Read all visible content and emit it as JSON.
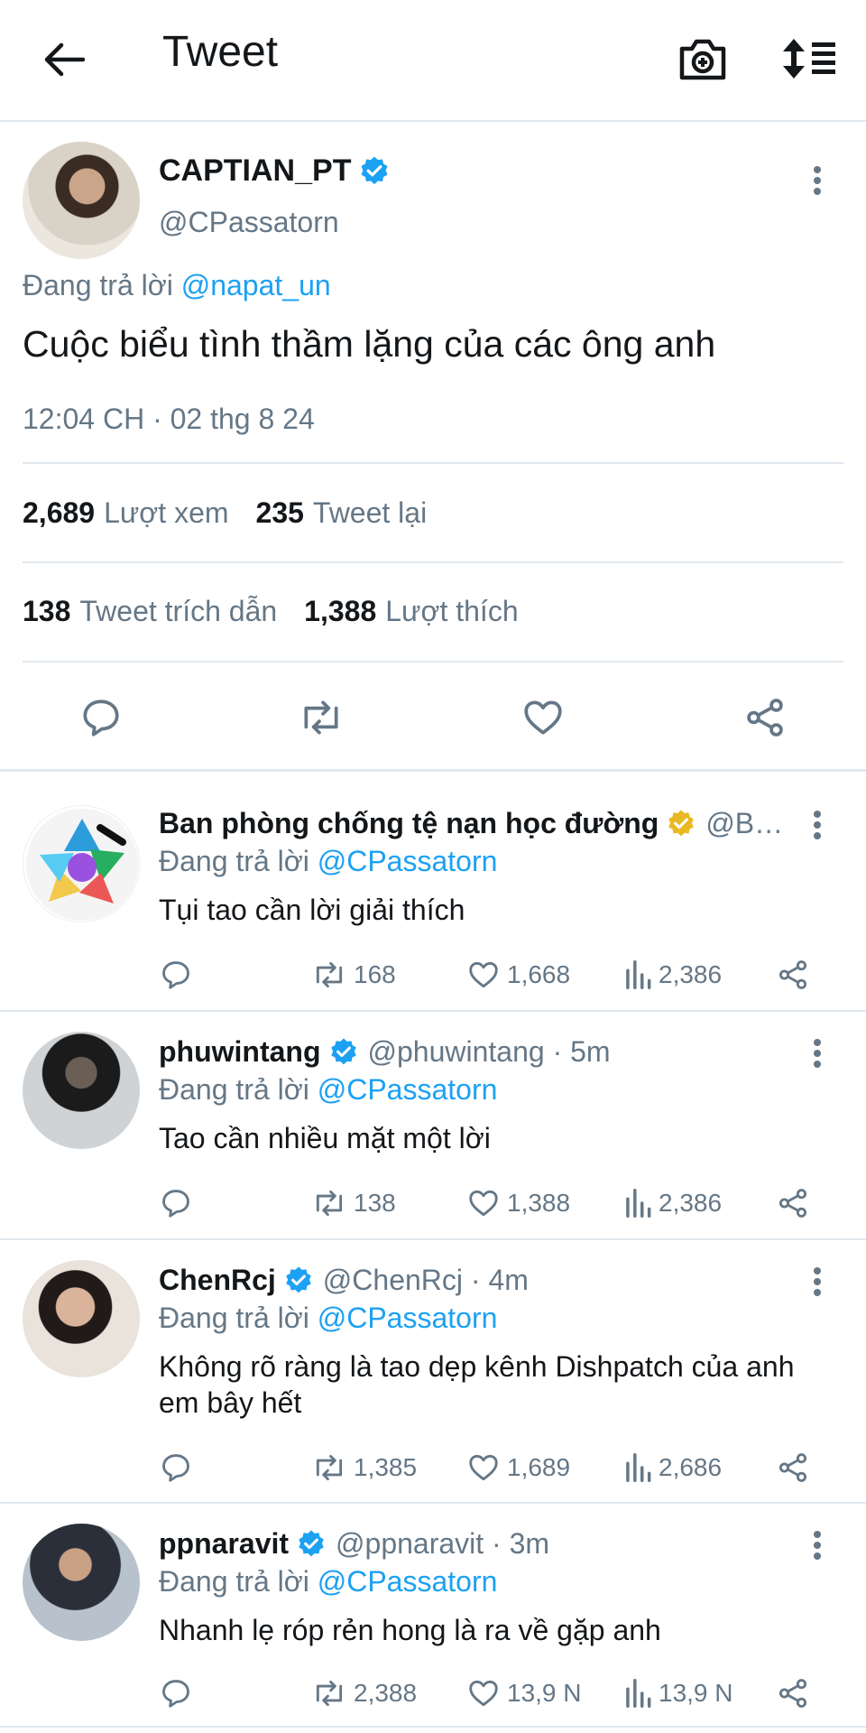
{
  "header": {
    "title": "Tweet"
  },
  "main_tweet": {
    "display_name": "CAPTIAN_PT",
    "handle": "@CPassatorn",
    "reply_prefix": "Đang trả lời",
    "reply_to": "@napat_un",
    "text": "Cuộc biểu tình thầm lặng của các ông anh",
    "timestamp": "12:04 CH · 02 thg 8 24",
    "views_count": "2,689",
    "views_label": "Lượt xem",
    "retweets_count": "235",
    "retweets_label": "Tweet lại",
    "quotes_count": "138",
    "quotes_label": "Tweet trích dẫn",
    "likes_count": "1,388",
    "likes_label": "Lượt thích"
  },
  "replies": [
    {
      "display_name": "Ban phòng chống tệ nạn học đường",
      "badge": "gold",
      "meta": "@B…",
      "reply_prefix": "Đang trả lời",
      "reply_to": "@CPassatorn",
      "text": "Tụi tao cần lời giải thích",
      "retweets": "168",
      "likes": "1,668",
      "views": "2,386"
    },
    {
      "display_name": "phuwintang",
      "badge": "blue",
      "meta": "@phuwintang · 5m",
      "reply_prefix": "Đang trả lời",
      "reply_to": "@CPassatorn",
      "text": "Tao cần nhiều mặt một lời",
      "retweets": "138",
      "likes": "1,388",
      "views": "2,386"
    },
    {
      "display_name": "ChenRcj",
      "badge": "blue",
      "meta": "@ChenRcj · 4m",
      "reply_prefix": "Đang trả lời",
      "reply_to": "@CPassatorn",
      "text": "Không rõ ràng là tao dẹp kênh Dishpatch của anh em bây hết",
      "retweets": "1,385",
      "likes": "1,689",
      "views": "2,686"
    },
    {
      "display_name": "ppnaravit",
      "badge": "blue",
      "meta": "@ppnaravit · 3m",
      "reply_prefix": "Đang trả lời",
      "reply_to": "@CPassatorn",
      "text": "Nhanh lẹ róp rẻn hong là ra về gặp anh",
      "retweets": "2,388",
      "likes": "13,9 N",
      "views": "13,9 N"
    }
  ],
  "icons": {
    "back": "arrow-left-icon",
    "camera": "camera-plus-icon",
    "sort": "sort-icon",
    "reply": "comment-icon",
    "retweet": "retweet-icon",
    "like": "heart-icon",
    "views": "analytics-icon",
    "share": "share-icon",
    "more": "more-vertical-icon",
    "verified": "verified-badge-icon"
  },
  "colors": {
    "accent": "#1da1f2",
    "gold_badge": "#e8b923",
    "secondary_text": "#657786",
    "divider": "#e1e8ed"
  }
}
